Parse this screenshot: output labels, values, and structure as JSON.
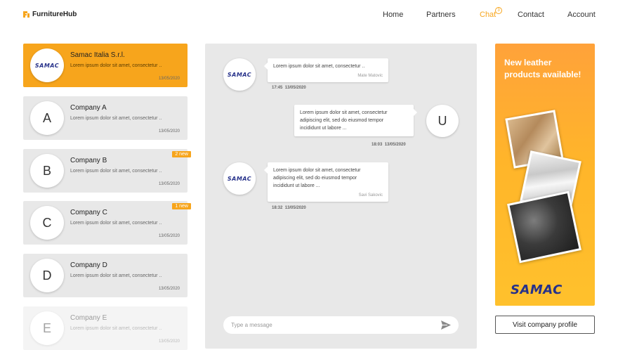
{
  "brand": {
    "name": "FurnitureHub",
    "accent": "#f7a51c"
  },
  "nav": {
    "items": [
      {
        "label": "Home",
        "active": false
      },
      {
        "label": "Partners",
        "active": false
      },
      {
        "label": "Chat",
        "active": true,
        "badge": "3"
      },
      {
        "label": "Contact",
        "active": false
      },
      {
        "label": "Account",
        "active": false
      }
    ]
  },
  "conversations": [
    {
      "name": "Samac Italia S.r.l.",
      "avatar": "SAMAC",
      "preview": "Lorem ipsum dolor sit amet, consectetur ..",
      "date": "13/05/2020",
      "selected": true,
      "badge": ""
    },
    {
      "name": "Company A",
      "avatar": "A",
      "preview": "Lorem ipsum dolor sit amet, consectetur ..",
      "date": "13/05/2020",
      "selected": false,
      "badge": ""
    },
    {
      "name": "Company B",
      "avatar": "B",
      "preview": "Lorem ipsum dolor sit amet, consectetur ..",
      "date": "13/05/2020",
      "selected": false,
      "badge": "2 new"
    },
    {
      "name": "Company C",
      "avatar": "C",
      "preview": "Lorem ipsum dolor sit amet, consectetur ..",
      "date": "13/05/2020",
      "selected": false,
      "badge": "1 new"
    },
    {
      "name": "Company D",
      "avatar": "D",
      "preview": "Lorem ipsum dolor sit amet, consectetur ..",
      "date": "13/05/2020",
      "selected": false,
      "badge": ""
    },
    {
      "name": "Company E",
      "avatar": "E",
      "preview": "Lorem ipsum dolor sit amet, consectetur ..",
      "date": "13/05/2020",
      "selected": false,
      "badge": ""
    }
  ],
  "chat": {
    "messages": [
      {
        "from": "them",
        "avatar": "SAMAC",
        "text": "Lorem ipsum dolor sit amet, consectetur ..",
        "author": "Mate Matovic",
        "time": "17:45",
        "date": "13/05/2020"
      },
      {
        "from": "me",
        "avatar": "U",
        "text": "Lorem ipsum dolor sit amet, consectetur\nadipiscing elit, sed do eiusmod tempor\nincididunt ut labore ...",
        "author": "",
        "time": "18:03",
        "date": "13/05/2020"
      },
      {
        "from": "them",
        "avatar": "SAMAC",
        "text": "Lorem ipsum dolor sit amet, consectetur\nadipiscing elit, sed do eiusmod tempor\nincididunt ut labore ...",
        "author": "Savi Sakovic",
        "time": "18:32",
        "date": "13/05/2020"
      }
    ],
    "input_placeholder": "Type a message",
    "send_icon": "send-arrow-icon"
  },
  "ad": {
    "headline": "New leather products available!",
    "logo": "SAMAC",
    "visit_label": "Visit company profile"
  }
}
